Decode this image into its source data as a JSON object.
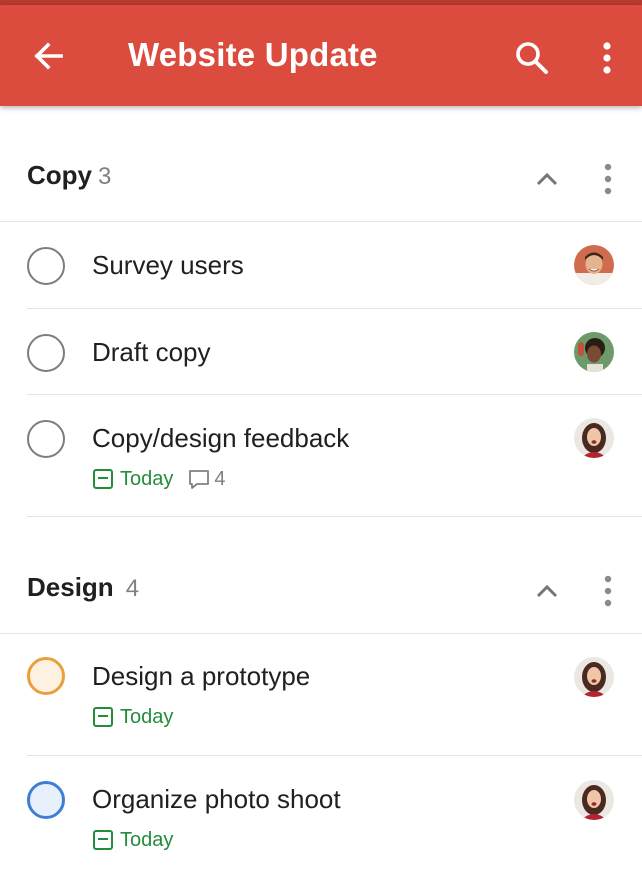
{
  "header": {
    "title": "Website Update",
    "back_icon": "arrow-left-icon",
    "search_icon": "search-icon",
    "menu_icon": "more-vertical-icon",
    "color": "#db4c3f"
  },
  "sections": [
    {
      "name": "Copy",
      "count": "3",
      "tasks": [
        {
          "title": "Survey users",
          "priority": "none",
          "assignee": "avatar-man-smiling"
        },
        {
          "title": "Draft copy",
          "priority": "none",
          "assignee": "avatar-woman-green-background"
        },
        {
          "title": "Copy/design feedback",
          "priority": "none",
          "due": "Today",
          "comments": "4",
          "assignee": "avatar-woman-red-top"
        }
      ]
    },
    {
      "name": "Design",
      "count": "4",
      "tasks": [
        {
          "title": "Design a prototype",
          "priority": "orange",
          "due": "Today",
          "assignee": "avatar-woman-red-top"
        },
        {
          "title": "Organize photo shoot",
          "priority": "blue",
          "due": "Today",
          "assignee": "avatar-woman-red-top"
        }
      ]
    }
  ],
  "colors": {
    "due_today": "#238d3b",
    "priority_orange": "#e9a03b",
    "priority_blue": "#3f7ed3"
  }
}
